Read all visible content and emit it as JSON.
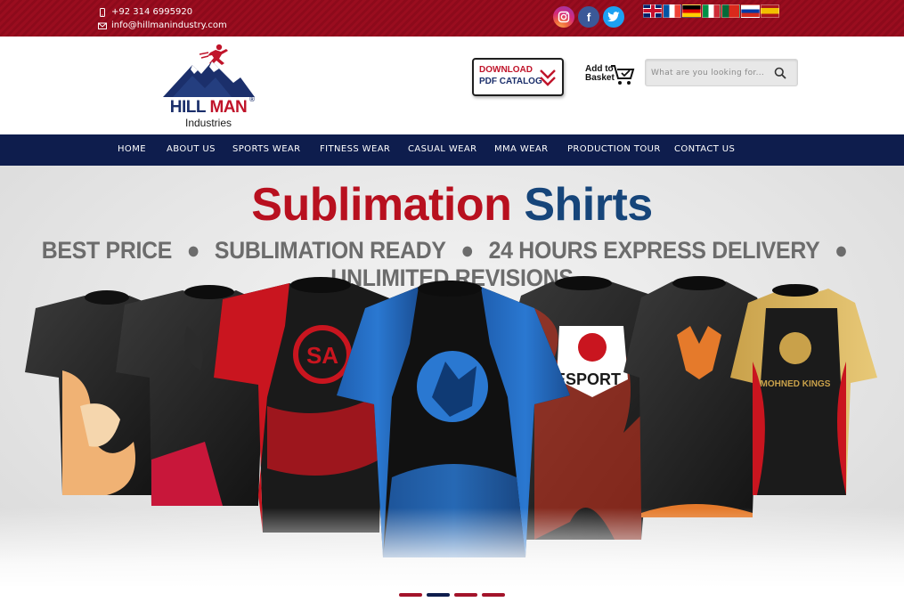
{
  "topbar": {
    "phone": "+92 314 6995920",
    "email": "info@hillmanindustry.com",
    "social": [
      "instagram-icon",
      "facebook-icon",
      "twitter-icon"
    ],
    "flags": [
      "flag-uk",
      "flag-fr",
      "flag-de",
      "flag-it",
      "flag-pt",
      "flag-ru",
      "flag-es"
    ]
  },
  "header": {
    "logo_word1": "HILL",
    "logo_word2": "MAN",
    "logo_sub": "Industries",
    "logo_reg": "®",
    "catalog_line1": "DOWNLOAD",
    "catalog_line2": "PDF CATALOG",
    "basket_line1": "Add to",
    "basket_line2": "Basket",
    "search_placeholder": "What are you looking for..."
  },
  "nav": {
    "items": [
      {
        "label": "HOME"
      },
      {
        "label": "ABOUT US"
      },
      {
        "label": "SPORTS WEAR"
      },
      {
        "label": "FITNESS WEAR"
      },
      {
        "label": "CASUAL WEAR"
      },
      {
        "label": "MMA WEAR"
      },
      {
        "label": "PRODUCTION TOUR"
      },
      {
        "label": "CONTACT US"
      }
    ]
  },
  "hero": {
    "title_word1": "Sublimation",
    "title_word2": "Shirts",
    "features": [
      "BEST PRICE",
      "SUBLIMATION READY",
      "24 HOURS EXPRESS DELIVERY",
      "UNLIMITED REVISIONS"
    ],
    "shirt_labels": [
      "ESPORT",
      "MOHNED KINGS"
    ]
  },
  "slider": {
    "dots": 4,
    "active_index": 1
  },
  "colors": {
    "brand_red": "#9a0d1f",
    "brand_navy": "#0e1d4d",
    "title_red": "#b8101f",
    "title_blue": "#16457a"
  }
}
